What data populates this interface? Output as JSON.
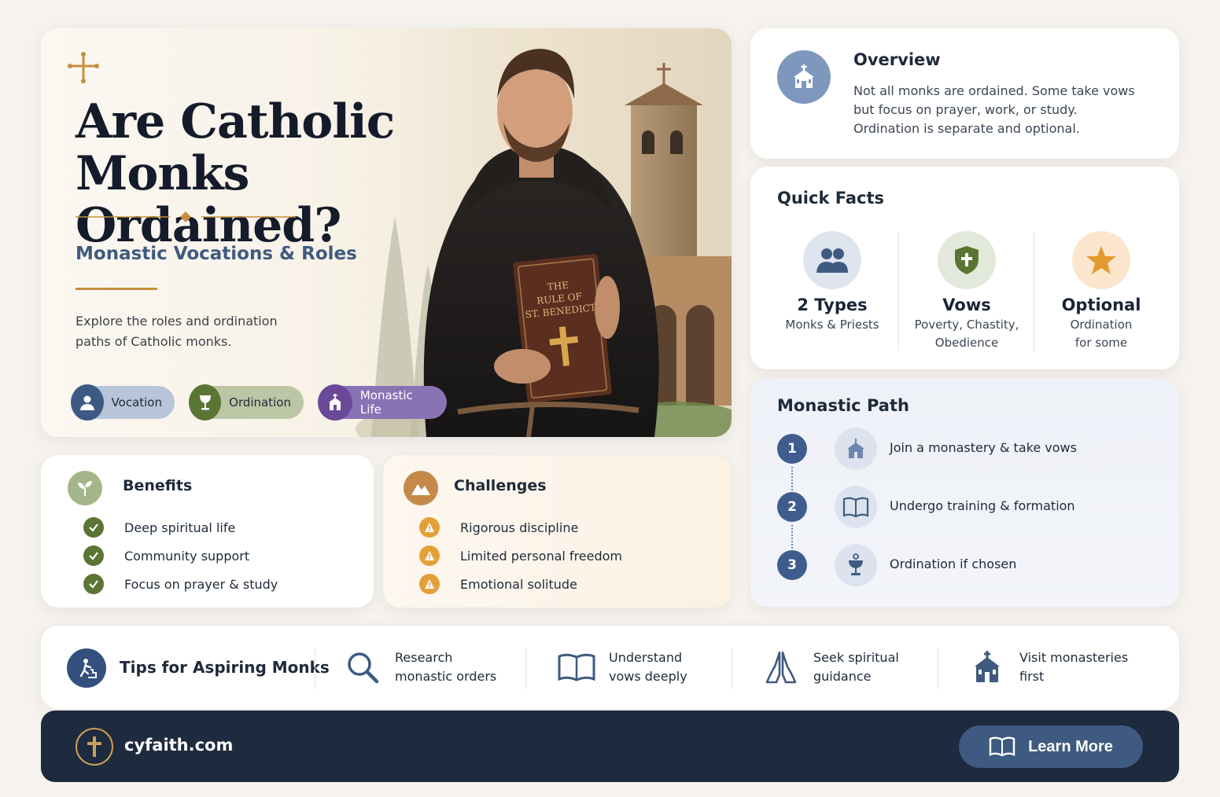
{
  "hero": {
    "title_line1": "Are Catholic",
    "title_line2": "Monks Ordained?",
    "subtitle": "Monastic Vocations & Roles",
    "description": "Explore the roles and ordination paths of Catholic monks.",
    "book_text_line1": "THE",
    "book_text_line2": "RULE OF",
    "book_text_line3": "ST. BENEDICT",
    "pills": [
      {
        "label": "Vocation",
        "icon": "person-icon"
      },
      {
        "label": "Ordination",
        "icon": "chalice-icon"
      },
      {
        "label": "Monastic Life",
        "icon": "church-icon"
      }
    ]
  },
  "overview": {
    "title": "Overview",
    "text": "Not all monks are ordained. Some take vows but focus on prayer, work, or study. Ordination is separate and optional."
  },
  "quick_facts": {
    "title": "Quick Facts",
    "items": [
      {
        "value": "2 Types",
        "desc_line1": "Monks & Priests",
        "desc_line2": "",
        "icon": "people-icon"
      },
      {
        "value": "Vows",
        "desc_line1": "Poverty, Chastity,",
        "desc_line2": "Obedience",
        "icon": "shield-cross-icon"
      },
      {
        "value": "Optional",
        "desc_line1": "Ordination",
        "desc_line2": "for some",
        "icon": "star-icon"
      }
    ]
  },
  "monastic_path": {
    "title": "Monastic Path",
    "steps": [
      {
        "num": "1",
        "text": "Join a monastery & take vows",
        "icon": "monastery-icon"
      },
      {
        "num": "2",
        "text": "Undergo training & formation",
        "icon": "book-icon"
      },
      {
        "num": "3",
        "text": "Ordination if chosen",
        "icon": "chalice-icon"
      }
    ]
  },
  "benefits": {
    "title": "Benefits",
    "items": [
      "Deep spiritual life",
      "Community support",
      "Focus on prayer & study"
    ]
  },
  "challenges": {
    "title": "Challenges",
    "items": [
      "Rigorous discipline",
      "Limited personal freedom",
      "Emotional solitude"
    ]
  },
  "tips": {
    "title": "Tips for Aspiring Monks",
    "items": [
      {
        "line1": "Research",
        "line2": "monastic orders",
        "icon": "magnifier-icon"
      },
      {
        "line1": "Understand",
        "line2": "vows deeply",
        "icon": "open-book-icon"
      },
      {
        "line1": "Seek spiritual",
        "line2": "guidance",
        "icon": "praying-hands-icon"
      },
      {
        "line1": "Visit monasteries",
        "line2": "first",
        "icon": "monastery-icon"
      }
    ]
  },
  "footer": {
    "site": "cyfaith.com",
    "button_label": "Learn More"
  },
  "colors": {
    "navy": "#1e2a3d",
    "accent_blue": "#3f5a80",
    "gold": "#c4903f",
    "green": "#5a7534",
    "purple": "#6a4a98"
  }
}
